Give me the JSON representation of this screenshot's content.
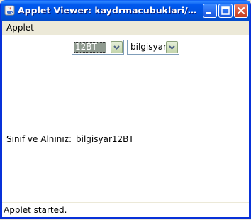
{
  "window": {
    "title": "Applet Viewer: kaydrmacubuklari/New...",
    "controls": {
      "minimize": "minimize",
      "maximize": "maximize",
      "close": "close"
    }
  },
  "menubar": {
    "items": [
      "Applet"
    ]
  },
  "applet": {
    "combo1": {
      "value": "12BT"
    },
    "combo2": {
      "value": "bilgisyar"
    },
    "result": {
      "label": "Sınıf ve Alnınız:",
      "value": "bilgisyar12BT"
    }
  },
  "status": {
    "text": "Applet started."
  },
  "colors": {
    "titlebar": "#0054e3",
    "frame": "#0831d9",
    "menubar": "#ece9d8",
    "content": "#ffffff",
    "combo_arrow": "#c5d6ad",
    "selection": "#8f9a8f"
  },
  "icons": [
    "java-cup-icon",
    "minimize-icon",
    "maximize-icon",
    "close-icon",
    "chevron-down-icon"
  ]
}
